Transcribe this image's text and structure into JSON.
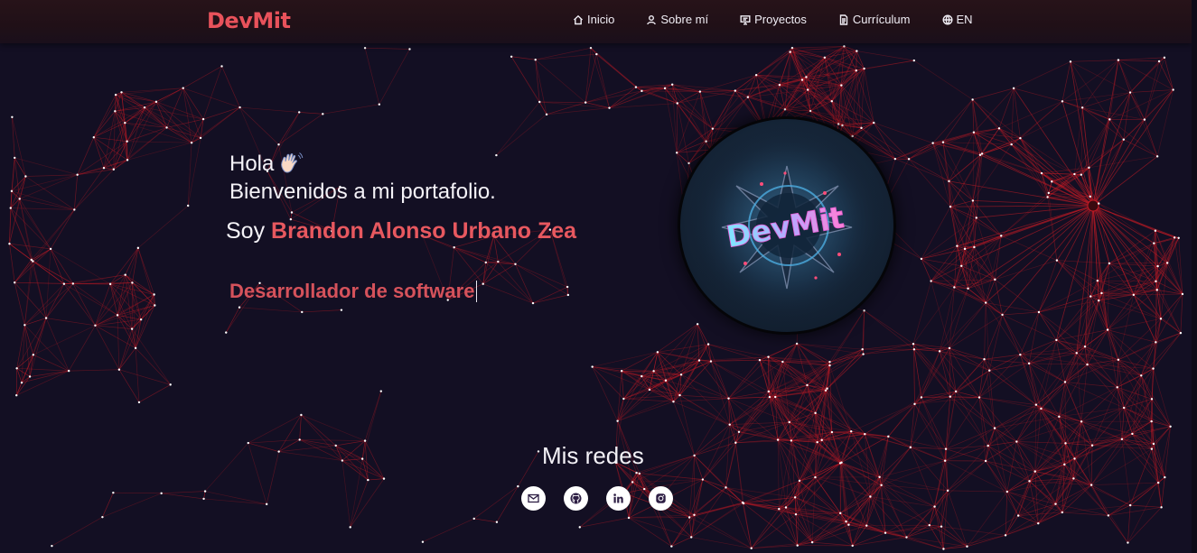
{
  "brand": {
    "name": "DevMit",
    "color": "#e8525b"
  },
  "nav": {
    "items": [
      {
        "label": "Inicio",
        "icon": "home-icon"
      },
      {
        "label": "Sobre mí",
        "icon": "user-icon"
      },
      {
        "label": "Proyectos",
        "icon": "presentation-icon"
      },
      {
        "label": "Currículum",
        "icon": "document-icon"
      },
      {
        "label": "EN",
        "icon": "globe-icon"
      }
    ]
  },
  "hero": {
    "greeting": "Hola",
    "greeting_icon": "waving-hand-icon",
    "welcome": "Bienvenidos a mi portafolio.",
    "intro_prefix": "Soy",
    "name": "Brandon Alonso Urbano Zea",
    "role": "Desarrollador de software",
    "accent_color": "#e7585f"
  },
  "avatar": {
    "text": "DevMit"
  },
  "social": {
    "title": "Mis redes",
    "links": [
      {
        "icon": "mail-icon"
      },
      {
        "icon": "github-icon"
      },
      {
        "icon": "linkedin-icon"
      },
      {
        "icon": "instagram-icon"
      }
    ]
  },
  "colors": {
    "background": "#130f23",
    "network_line": "#c21a25",
    "network_node": "#ffffff"
  }
}
